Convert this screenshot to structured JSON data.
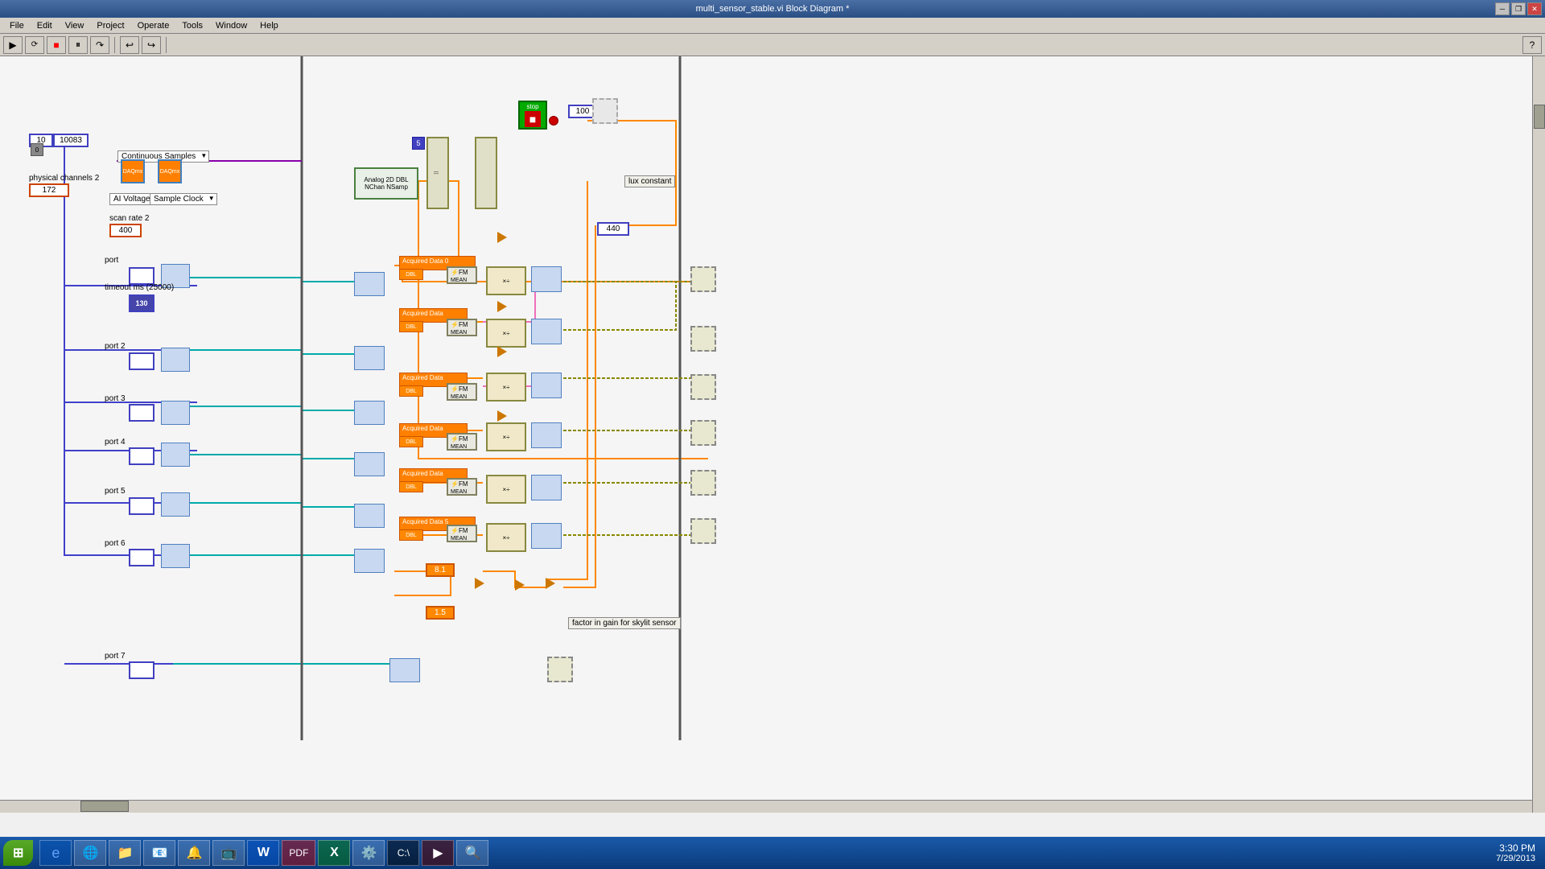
{
  "window": {
    "title": "multi_sensor_stable.vi Block Diagram *",
    "menu": [
      "File",
      "Edit",
      "View",
      "Project",
      "Operate",
      "Tools",
      "Window",
      "Help"
    ]
  },
  "diagram": {
    "labels": {
      "stop": "stop",
      "lux_constant": "lux constant",
      "physical_channels": "physical channels 2",
      "continuous_samples": "Continuous Samples",
      "ai_voltage": "AI Voltage",
      "sample_clock": "Sample Clock",
      "scan_rate": "scan rate 2",
      "timeout": "timeout ms (25000)",
      "port": "port",
      "port2": "port 2",
      "port3": "port 3",
      "port4": "port 4",
      "port5": "port 5",
      "port6": "port 6",
      "port7": "port 7",
      "analog_block": "Analog 2D DBL\nNChan NSamp",
      "acq0": "Acquired Data 0",
      "acq1": "Acquired Data",
      "acq2": "Acquired Data",
      "acq3": "Acquired Data",
      "acq4": "Acquired Data",
      "acq5": "Acquired Data 5",
      "factor_label": "factor in gain for skylit sensor",
      "val_100": "100",
      "val_440": "440",
      "val_10": "10",
      "val_10083": "10083",
      "val_8_1": "8.1",
      "val_1_5": "1.5"
    }
  },
  "taskbar": {
    "time": "3:30 PM",
    "date": "7/29/2013",
    "apps": [
      "⊞",
      "IE",
      "Chrome",
      "Folder",
      "Mail",
      "App5",
      "VLC",
      "Word",
      "PDF",
      "Excel",
      "App10",
      "CMD",
      "Play",
      "App13"
    ]
  }
}
